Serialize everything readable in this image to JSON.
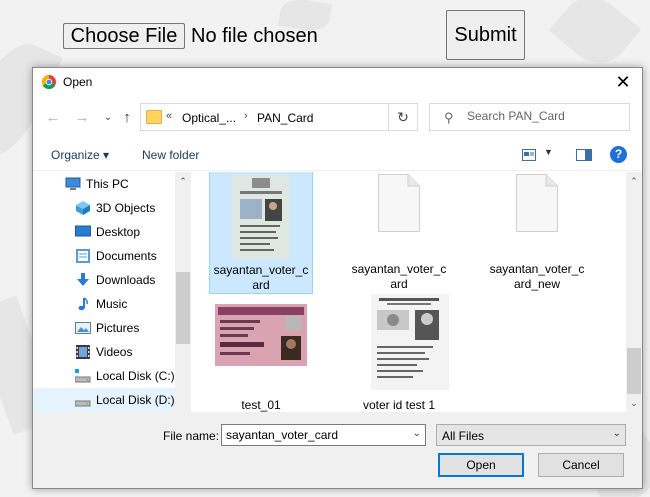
{
  "page": {
    "choose_file_label": "Choose File",
    "no_file_text": "No file chosen",
    "submit_label": "Submit"
  },
  "dialog": {
    "title": "Open",
    "close_label": "✕",
    "address": {
      "overflow": "«",
      "segments": [
        "Optical_...",
        "PAN_Card"
      ]
    },
    "search_placeholder": "Search PAN_Card",
    "toolbar": {
      "organize_label": "Organize ▾",
      "new_folder_label": "New folder",
      "help_label": "?"
    },
    "nav_items": [
      {
        "label": "This PC",
        "icon": "pc-icon"
      },
      {
        "label": "3D Objects",
        "icon": "3d-objects-icon"
      },
      {
        "label": "Desktop",
        "icon": "desktop-icon"
      },
      {
        "label": "Documents",
        "icon": "documents-icon"
      },
      {
        "label": "Downloads",
        "icon": "downloads-icon"
      },
      {
        "label": "Music",
        "icon": "music-icon"
      },
      {
        "label": "Pictures",
        "icon": "pictures-icon"
      },
      {
        "label": "Videos",
        "icon": "videos-icon"
      },
      {
        "label": "Local Disk (C:)",
        "icon": "drive-icon"
      },
      {
        "label": "Local Disk (D:)",
        "icon": "drive-icon"
      }
    ],
    "files": [
      {
        "name_line1": "sayantan_voter_c",
        "name_line2": "ard",
        "selected": true,
        "thumb": "voter-card-photo"
      },
      {
        "name_line1": "sayantan_voter_c",
        "name_line2": "ard",
        "selected": false,
        "thumb": "blank-document"
      },
      {
        "name_line1": "sayantan_voter_c",
        "name_line2": "ard_new",
        "selected": false,
        "thumb": "blank-document"
      },
      {
        "name_line1": "test_01",
        "name_line2": "",
        "selected": false,
        "thumb": "pan-card-photo"
      },
      {
        "name_line1": "voter id test 1",
        "name_line2": "",
        "selected": false,
        "thumb": "voter-id-photo"
      }
    ],
    "file_name_label": "File name:",
    "file_name_value": "sayantan_voter_card",
    "file_type_value": "All Files",
    "open_label": "Open",
    "cancel_label": "Cancel"
  },
  "colors": {
    "selection": "#cce8ff",
    "accent": "#0078d7",
    "link": "#1e395b"
  }
}
